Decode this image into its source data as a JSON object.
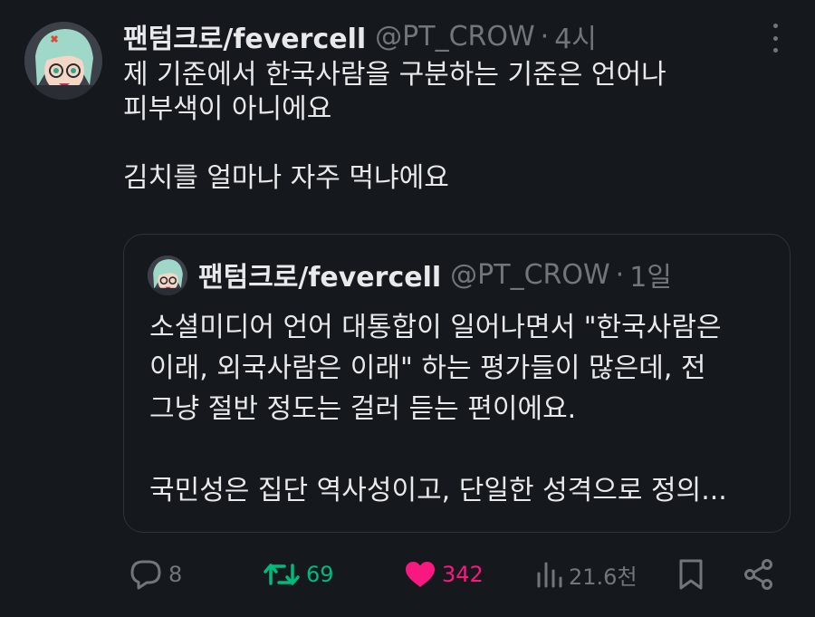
{
  "tweet": {
    "display_name": "팬텀크로/fevercell",
    "handle": "@PT_CROW",
    "separator": "·",
    "time": "4시",
    "body": [
      "제 기준에서 한국사람을 구분하는 기준은 언어나",
      "피부색이 아니에요",
      "",
      "김치를 얼마나 자주 먹냐에요"
    ]
  },
  "quoted": {
    "display_name": "팬텀크로/fevercell",
    "handle": "@PT_CROW",
    "separator": "·",
    "time": "1일",
    "body": [
      "소셜미디어 언어 대통합이 일어나면서 \"한국사람은",
      "이래, 외국사람은 이래\" 하는 평가들이 많은데, 전",
      "그냥 절반 정도는 걸러 듣는 편이에요.",
      "",
      "국민성은 집단 역사성이고, 단일한 성격으로 정의..."
    ]
  },
  "actions": {
    "replies": "8",
    "reposts": "69",
    "likes": "342",
    "views": "21.6천"
  },
  "icons": {
    "reply": "reply-icon",
    "repost": "repost-icon",
    "like": "heart-icon",
    "views": "views-icon",
    "bookmark": "bookmark-icon",
    "share": "share-icon",
    "more": "more-icon"
  },
  "colors": {
    "background": "#15181c",
    "text": "#e7e9ea",
    "muted": "#71767b",
    "repost_active": "#00ba7c",
    "like_active": "#f91880",
    "border": "#2f3336"
  }
}
